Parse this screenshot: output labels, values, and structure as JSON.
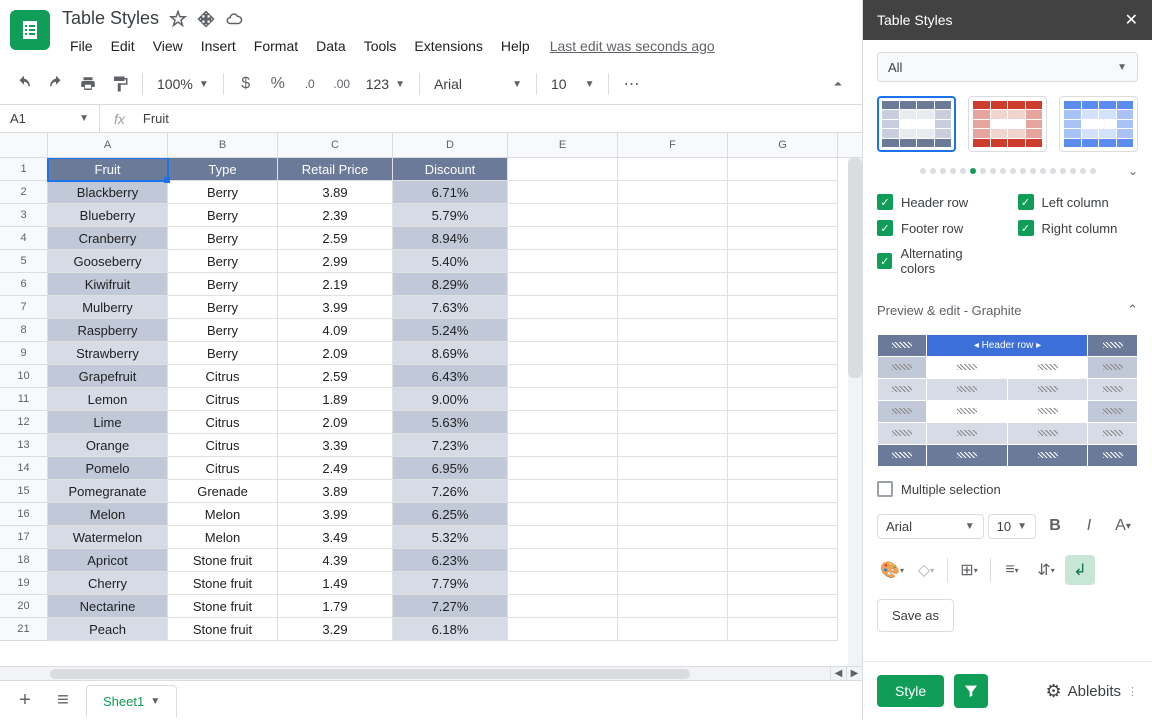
{
  "doc": {
    "title": "Table Styles",
    "last_edit": "Last edit was seconds ago"
  },
  "menu": [
    "File",
    "Edit",
    "View",
    "Insert",
    "Format",
    "Data",
    "Tools",
    "Extensions",
    "Help"
  ],
  "toolbar": {
    "zoom": "100%",
    "font": "Arial",
    "size": "10"
  },
  "formula": {
    "cell": "A1",
    "value": "Fruit"
  },
  "columns": [
    "A",
    "B",
    "C",
    "D",
    "E",
    "F",
    "G"
  ],
  "headers": [
    "Fruit",
    "Type",
    "Retail Price",
    "Discount"
  ],
  "rows": [
    [
      "Blackberry",
      "Berry",
      "3.89",
      "6.71%"
    ],
    [
      "Blueberry",
      "Berry",
      "2.39",
      "5.79%"
    ],
    [
      "Cranberry",
      "Berry",
      "2.59",
      "8.94%"
    ],
    [
      "Gooseberry",
      "Berry",
      "2.99",
      "5.40%"
    ],
    [
      "Kiwifruit",
      "Berry",
      "2.19",
      "8.29%"
    ],
    [
      "Mulberry",
      "Berry",
      "3.99",
      "7.63%"
    ],
    [
      "Raspberry",
      "Berry",
      "4.09",
      "5.24%"
    ],
    [
      "Strawberry",
      "Berry",
      "2.09",
      "8.69%"
    ],
    [
      "Grapefruit",
      "Citrus",
      "2.59",
      "6.43%"
    ],
    [
      "Lemon",
      "Citrus",
      "1.89",
      "9.00%"
    ],
    [
      "Lime",
      "Citrus",
      "2.09",
      "5.63%"
    ],
    [
      "Orange",
      "Citrus",
      "3.39",
      "7.23%"
    ],
    [
      "Pomelo",
      "Citrus",
      "2.49",
      "6.95%"
    ],
    [
      "Pomegranate",
      "Grenade",
      "3.89",
      "7.26%"
    ],
    [
      "Melon",
      "Melon",
      "3.99",
      "6.25%"
    ],
    [
      "Watermelon",
      "Melon",
      "3.49",
      "5.32%"
    ],
    [
      "Apricot",
      "Stone fruit",
      "4.39",
      "6.23%"
    ],
    [
      "Cherry",
      "Stone fruit",
      "1.49",
      "7.79%"
    ],
    [
      "Nectarine",
      "Stone fruit",
      "1.79",
      "7.27%"
    ],
    [
      "Peach",
      "Stone fruit",
      "3.29",
      "6.18%"
    ]
  ],
  "sheet": {
    "name": "Sheet1"
  },
  "sidebar": {
    "title": "Table Styles",
    "filter": "All",
    "checks": {
      "header": "Header row",
      "left": "Left column",
      "footer": "Footer row",
      "right": "Right column",
      "alt": "Alternating colors"
    },
    "preview_title": "Preview & edit - Graphite",
    "preview_sel": "Header row",
    "multi": "Multiple selection",
    "font": "Arial",
    "size": "10",
    "save": "Save as",
    "style": "Style",
    "brand": "Ablebits"
  }
}
